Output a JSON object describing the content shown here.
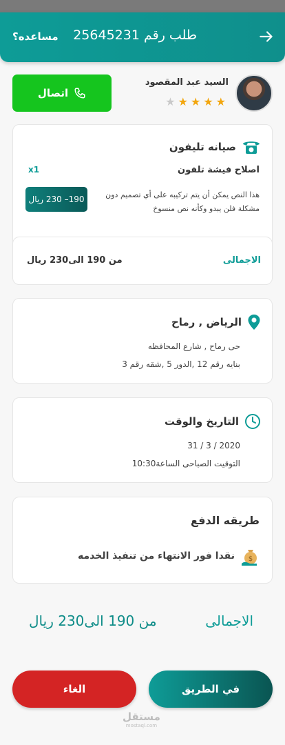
{
  "header": {
    "title": "طلب رقم 25645231",
    "help": "مساعده؟"
  },
  "provider": {
    "name": "السيد عبد المقصود",
    "rating": 4,
    "rating_max": 5,
    "call_label": "اتصال"
  },
  "service": {
    "title": "صيانه تليفون",
    "subtitle": "اصلاح فيشة تلفون",
    "qty": "x1",
    "description": "هذا النص يمكن أن يتم تركيبه على أي تصميم دون مشكلة فلن يبدو وكأنه نص منسوخ",
    "price_range": "190– 230 ريال",
    "total_label": "الاجمالى",
    "total_value": "من 190 الى230 ريال"
  },
  "location": {
    "title": "الرياض , رماح",
    "line1": "حى رماح , شارع المحافظه",
    "line2": "بنايه رقم 12 ,الدور 5 ,شقه رقم 3"
  },
  "datetime": {
    "title": "التاريخ والوقت",
    "date": "31 / 3 / 2020",
    "time": "التوقيت الصباحى الساعة10:30"
  },
  "payment": {
    "title": "طريقه الدفع",
    "method": "نقدا فور الانتهاء من تنفيذ الخدمه"
  },
  "grand_total": {
    "label": "الاجمالى",
    "value": "من 190 الى230 ريال"
  },
  "actions": {
    "on_the_way": "في الطريق",
    "cancel": "الغاء"
  },
  "watermark": {
    "arabic": "مستقل",
    "latin": "mostaql.com"
  },
  "colors": {
    "primary": "#0e9c97",
    "call_green": "#15c51e",
    "cancel_red": "#d42424",
    "star": "#f2a60f"
  }
}
